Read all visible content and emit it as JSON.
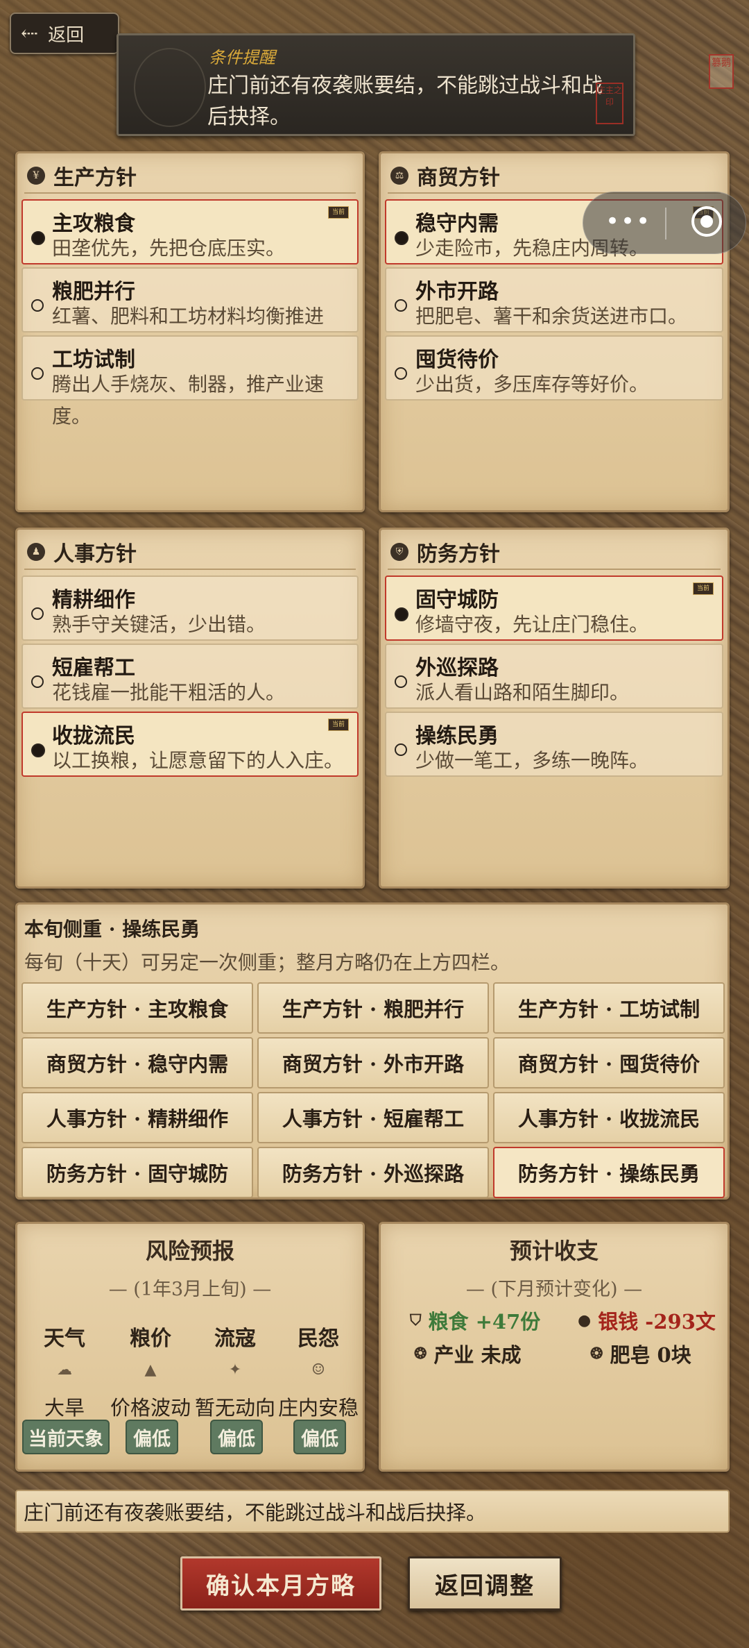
{
  "header": {
    "back_label": "返回",
    "back_icon": "arrow-left-icon",
    "notice_title": "条件提醒",
    "notice_text": "庄门前还有夜袭账要结，不能跳过战斗和战后抉择。",
    "notice_seal": "庄主之印",
    "corner_seal": "篡鹅"
  },
  "panels": [
    {
      "title": "生产方针",
      "icon": "coin-icon",
      "icon_glyph": "¥",
      "options": [
        {
          "name": "主攻粮食",
          "desc": "田垄优先，先把仓底压实。",
          "selected": true
        },
        {
          "name": "粮肥并行",
          "desc": "红薯、肥料和工坊材料均衡推进",
          "selected": false
        },
        {
          "name": "工坊试制",
          "desc": "腾出人手烧灰、制器，推产业速度。",
          "selected": false
        }
      ]
    },
    {
      "title": "商贸方针",
      "icon": "scale-icon",
      "icon_glyph": "⚖",
      "options": [
        {
          "name": "稳守内需",
          "desc": "少走险市，先稳庄内周转。",
          "selected": true
        },
        {
          "name": "外市开路",
          "desc": "把肥皂、薯干和余货送进市口。",
          "selected": false
        },
        {
          "name": "囤货待价",
          "desc": "少出货，多压库存等好价。",
          "selected": false
        }
      ]
    },
    {
      "title": "人事方针",
      "icon": "people-icon",
      "icon_glyph": "♟",
      "options": [
        {
          "name": "精耕细作",
          "desc": "熟手守关键活，少出错。",
          "selected": false
        },
        {
          "name": "短雇帮工",
          "desc": "花钱雇一批能干粗活的人。",
          "selected": false
        },
        {
          "name": "收拢流民",
          "desc": "以工换粮，让愿意留下的人入庄。",
          "selected": true
        }
      ]
    },
    {
      "title": "防务方针",
      "icon": "helmet-icon",
      "icon_glyph": "⛨",
      "options": [
        {
          "name": "固守城防",
          "desc": "修墙守夜，先让庄门稳住。",
          "selected": true
        },
        {
          "name": "外巡探路",
          "desc": "派人看山路和陌生脚印。",
          "selected": false
        },
        {
          "name": "操练民勇",
          "desc": "少做一笔工，多练一晚阵。",
          "selected": false
        }
      ]
    }
  ],
  "badge_label": "当前",
  "focus": {
    "title": "本旬侧重 · 操练民勇",
    "subtitle": "每旬（十天）可另定一次侧重；整月方略仍在上方四栏。",
    "buttons": [
      "生产方针 · 主攻粮食",
      "生产方针 · 粮肥并行",
      "生产方针 · 工坊试制",
      "商贸方针 · 稳守内需",
      "商贸方针 · 外市开路",
      "商贸方针 · 囤货待价",
      "人事方针 · 精耕细作",
      "人事方针 · 短雇帮工",
      "人事方针 · 收拢流民",
      "防务方针 · 固守城防",
      "防务方针 · 外巡探路",
      "防务方针 · 操练民勇"
    ],
    "selected_index": 11
  },
  "risk": {
    "title": "风险预报",
    "subtitle": "— (1年3月上旬) —",
    "cols": [
      {
        "label": "天气",
        "icon": "cloud-icon",
        "glyph": "☁",
        "value": "大旱",
        "tag": "当前天象"
      },
      {
        "label": "粮价",
        "icon": "grain-sack-icon",
        "glyph": "▲",
        "value": "价格波动",
        "tag": "偏低"
      },
      {
        "label": "流寇",
        "icon": "bandit-icon",
        "glyph": "✦",
        "value": "暂无动向",
        "tag": "偏低"
      },
      {
        "label": "民怨",
        "icon": "face-icon",
        "glyph": "☺",
        "value": "庄内安稳",
        "tag": "偏低"
      }
    ]
  },
  "budget": {
    "title": "预计收支",
    "subtitle": "— (下月预计变化) —",
    "grain": "粮食 +47份",
    "silver": "银钱 -293文",
    "industry": "产业 未成",
    "soap": "肥皂 0块",
    "grain_color": "#3e7a3a",
    "silver_color": "#a4241b"
  },
  "footer": {
    "note": "庄门前还有夜袭账要结，不能跳过战斗和战后抉择。",
    "confirm_label": "确认本月方略",
    "return_label": "返回调整"
  },
  "capsule": {
    "more_icon": "more-dots-icon",
    "close_icon": "target-close-icon"
  }
}
